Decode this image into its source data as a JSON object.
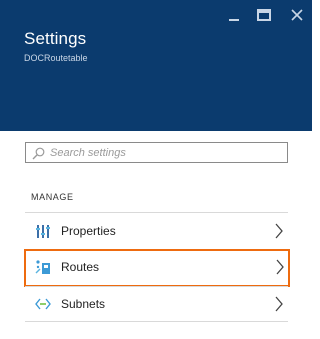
{
  "window_controls": {
    "minimize": "minimize-icon",
    "maximize": "maximize-icon",
    "close": "close-icon"
  },
  "header": {
    "title": "Settings",
    "subtitle": "DOCRoutetable",
    "background_color": "#0b3b6e"
  },
  "search": {
    "placeholder": "Search settings",
    "value": ""
  },
  "section": {
    "label": "MANAGE"
  },
  "menu": [
    {
      "label": "Properties",
      "icon": "properties-icon",
      "selected": false
    },
    {
      "label": "Routes",
      "icon": "routes-icon",
      "selected": true
    },
    {
      "label": "Subnets",
      "icon": "subnets-icon",
      "selected": false
    }
  ],
  "colors": {
    "accent_selection": "#ee6b0f",
    "icon_blue": "#3c9ad6"
  }
}
